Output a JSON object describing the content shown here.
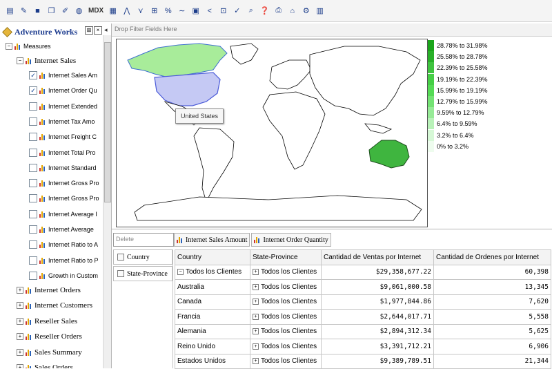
{
  "toolbar": {
    "buttons": [
      "new-report",
      "open",
      "save",
      "open-folder",
      "edit",
      "globe",
      "mdx",
      "grid",
      "chart",
      "filter",
      "table",
      "percent",
      "trend",
      "view",
      "share",
      "export",
      "check",
      "search",
      "help",
      "print",
      "print-preview",
      "options",
      "pdf"
    ],
    "mdx_label": "MDX"
  },
  "tree": {
    "cube_name": "Adventure Works",
    "measures_label": "Measures",
    "group_label": "Internet Sales",
    "items": [
      {
        "label": "Internet Sales Am",
        "checked": true
      },
      {
        "label": "Internet Order Qu",
        "checked": true
      },
      {
        "label": "Internet Extended",
        "checked": false
      },
      {
        "label": "Internet Tax Amo",
        "checked": false
      },
      {
        "label": "Internet Freight C",
        "checked": false
      },
      {
        "label": "Internet Total Pro",
        "checked": false
      },
      {
        "label": "Internet Standard",
        "checked": false
      },
      {
        "label": "Internet Gross Pro",
        "checked": false
      },
      {
        "label": "Internet Gross Pro",
        "checked": false
      },
      {
        "label": "Internet Average I",
        "checked": false
      },
      {
        "label": "Internet Average ",
        "checked": false
      },
      {
        "label": "Internet Ratio to A",
        "checked": false
      },
      {
        "label": "Internet Ratio to P",
        "checked": false
      },
      {
        "label": "Growth in Custom",
        "checked": false
      }
    ],
    "groups": [
      "Internet Orders",
      "Internet Customers",
      "Reseller Sales",
      "Reseller Orders",
      "Sales Summary",
      "Sales Orders"
    ]
  },
  "filter_bar": {
    "placeholder": "Drop Filter Fields Here"
  },
  "map": {
    "tooltip": "United States",
    "legend": [
      {
        "label": "28.78% to 31.98%",
        "color": "#1aa51a"
      },
      {
        "label": "25.58% to 28.78%",
        "color": "#28b028"
      },
      {
        "label": "22.39% to 25.58%",
        "color": "#3fc43f"
      },
      {
        "label": "19.19% to 22.39%",
        "color": "#46cf46"
      },
      {
        "label": "15.99% to 19.19%",
        "color": "#55db55"
      },
      {
        "label": "12.79% to 15.99%",
        "color": "#74e374"
      },
      {
        "label": "9.59% to 12.79%",
        "color": "#97eb97"
      },
      {
        "label": "6.4% to 9.59%",
        "color": "#b9f2b9"
      },
      {
        "label": "3.2% to 6.4%",
        "color": "#d6f8d6"
      },
      {
        "label": "0% to 3.2%",
        "color": "#eefcee"
      }
    ]
  },
  "pivot": {
    "delete_label": "Delete",
    "row_fields": [
      "Country",
      "State-Province"
    ],
    "measure_tabs": [
      "Internet Sales Amount",
      "Internet Order Quantity"
    ],
    "headers": [
      "Country",
      "State-Province",
      "Cantidad de Ventas por Internet",
      "Cantidad de Ordenes por Internet"
    ],
    "rows": [
      {
        "country": "Todos los Clientes",
        "state": "Todos los Clientes",
        "sales": "$29,358,677.22",
        "orders": "60,398",
        "expanded": true
      },
      {
        "country": "Australia",
        "state": "Todos los Clientes",
        "sales": "$9,061,000.58",
        "orders": "13,345"
      },
      {
        "country": "Canada",
        "state": "Todos los Clientes",
        "sales": "$1,977,844.86",
        "orders": "7,620"
      },
      {
        "country": "Francia",
        "state": "Todos los Clientes",
        "sales": "$2,644,017.71",
        "orders": "5,558"
      },
      {
        "country": "Alemania",
        "state": "Todos los Clientes",
        "sales": "$2,894,312.34",
        "orders": "5,625"
      },
      {
        "country": "Reino Unido",
        "state": "Todos los Clientes",
        "sales": "$3,391,712.21",
        "orders": "6,906"
      },
      {
        "country": "Estados Unidos",
        "state": "Todos los Clientes",
        "sales": "$9,389,789.51",
        "orders": "21,344"
      }
    ]
  }
}
